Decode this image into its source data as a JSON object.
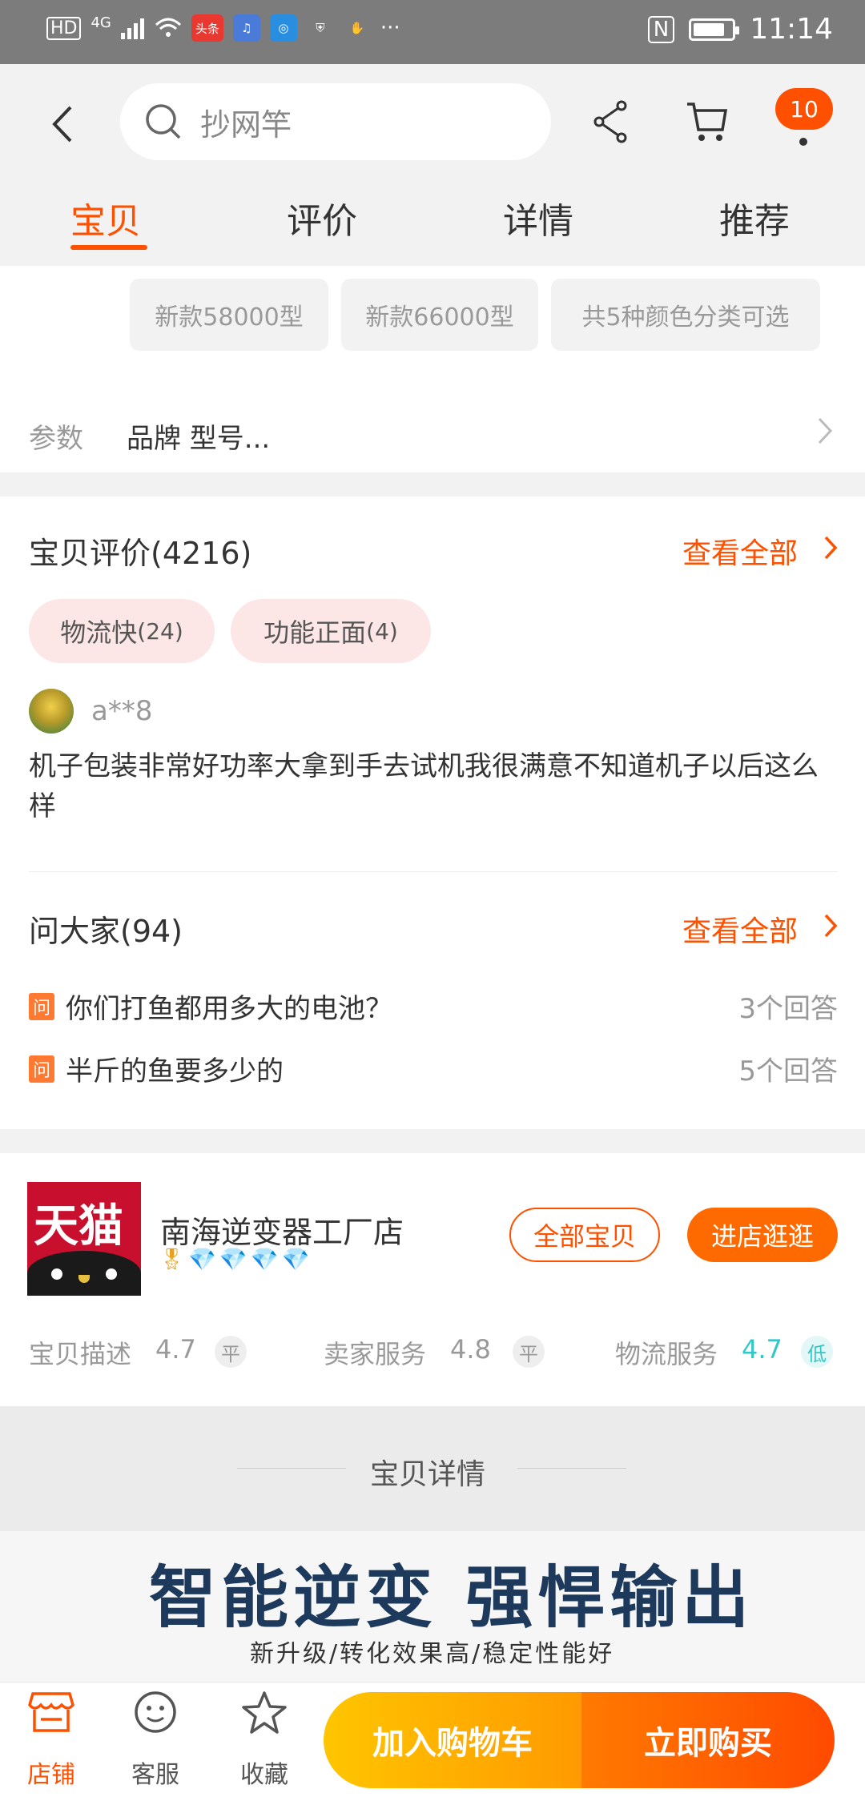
{
  "status_bar": {
    "hd": "HD",
    "network": "4G",
    "app_badge": "头条",
    "time": "11:14",
    "more": "···"
  },
  "header": {
    "search_text": "抄网竿",
    "cart_badge": "10",
    "tabs": [
      "宝贝",
      "评价",
      "详情",
      "推荐"
    ],
    "active_tab": 0
  },
  "sku": {
    "chips": [
      "新款58000型",
      "新款66000型",
      "共5种颜色分类可选"
    ]
  },
  "params": {
    "label": "参数",
    "value": "品牌 型号..."
  },
  "reviews": {
    "title": "宝贝评价(4216)",
    "view_all": "查看全部",
    "tags": [
      {
        "name": "物流快",
        "count": "(24)"
      },
      {
        "name": "功能正面",
        "count": "(4)"
      }
    ],
    "review": {
      "user": "a**8",
      "text": "机子包装非常好功率大拿到手去试机我很满意不知道机子以后这么样"
    }
  },
  "qa": {
    "title": "问大家(94)",
    "view_all": "查看全部",
    "tag": "问",
    "items": [
      {
        "question": "你们打鱼都用多大的电池？",
        "answers": "3个回答"
      },
      {
        "question": "半斤的鱼要多少的",
        "answers": "5个回答"
      }
    ]
  },
  "shop": {
    "logo_text": "天猫",
    "name": "南海逆变器工厂店",
    "all_items": "全部宝贝",
    "enter_shop": "进店逛逛",
    "ratings": [
      {
        "label": "宝贝描述",
        "score": "4.7",
        "level": "平"
      },
      {
        "label": "卖家服务",
        "score": "4.8",
        "level": "平"
      },
      {
        "label": "物流服务",
        "score": "4.7",
        "level": "低"
      }
    ]
  },
  "detail": {
    "title": "宝贝详情",
    "banner_title": "智能逆变 强悍输出",
    "banner_subtitle": "新升级/转化效果高/稳定性能好"
  },
  "bottom_bar": {
    "shop_label": "店铺",
    "service_label": "客服",
    "fav_label": "收藏",
    "add_cart": "加入购物车",
    "buy_now": "立即购买"
  },
  "colors": {
    "accent": "#ff5000",
    "teal": "#33c7c7"
  }
}
